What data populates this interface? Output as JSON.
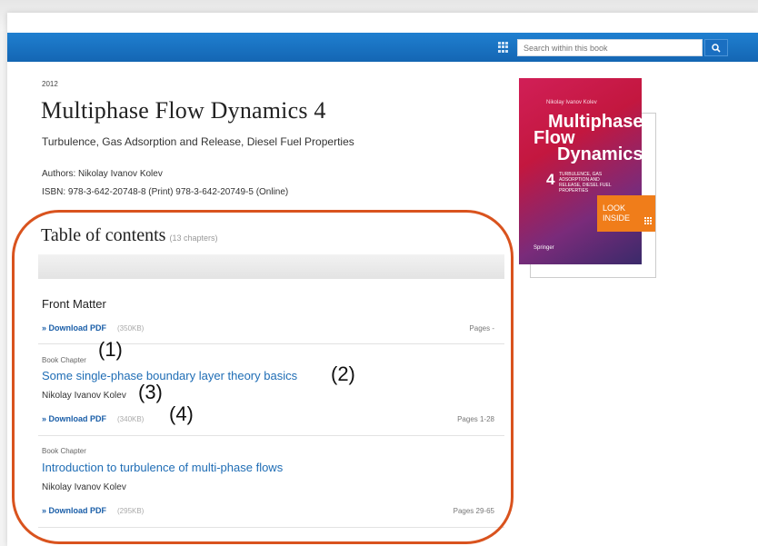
{
  "colors": {
    "brand_blue": "#1466b3",
    "link": "#1f6db5",
    "accent_orange": "#f07d1a",
    "callout": "#d9531e"
  },
  "header": {
    "search_placeholder": "Search within this book",
    "grid_icon": "grid-icon",
    "search_icon": "magnifier-icon"
  },
  "book": {
    "year": "2012",
    "title": "Multiphase Flow Dynamics 4",
    "subtitle": "Turbulence, Gas Adsorption and Release, Diesel Fuel Properties",
    "authors": "Authors: Nikolay Ivanov Kolev",
    "isbn": "ISBN: 978-3-642-20748-8 (Print) 978-3-642-20749-5 (Online)"
  },
  "cover": {
    "author": "Nikolay Ivanov Kolev",
    "title_1": "Multiphase",
    "title_2": "Flow",
    "title_3": "Dynamics",
    "volume": "4",
    "small_text": "TURBULENCE, GAS ADSORPTION AND RELEASE, DIESEL FUEL PROPERTIES",
    "publisher": "Springer",
    "look_inside_1": "LOOK",
    "look_inside_2": "INSIDE"
  },
  "toc": {
    "heading": "Table of contents",
    "count": "(13 chapters)",
    "front_matter": {
      "title": "Front Matter",
      "download": "» Download PDF",
      "size": "(350KB)",
      "pages": "Pages -"
    },
    "chapters": [
      {
        "type": "Book Chapter",
        "title": "Some single-phase boundary layer theory basics",
        "author": "Nikolay Ivanov Kolev",
        "download": "» Download PDF",
        "size": "(340KB)",
        "pages": "Pages 1-28"
      },
      {
        "type": "Book Chapter",
        "title": "Introduction to turbulence of multi-phase flows",
        "author": "Nikolay Ivanov Kolev",
        "download": "» Download PDF",
        "size": "(295KB)",
        "pages": "Pages 29-65"
      }
    ]
  },
  "annotations": {
    "a1": "(1)",
    "a2": "(2)",
    "a3": "(3)",
    "a4": "(4)"
  }
}
